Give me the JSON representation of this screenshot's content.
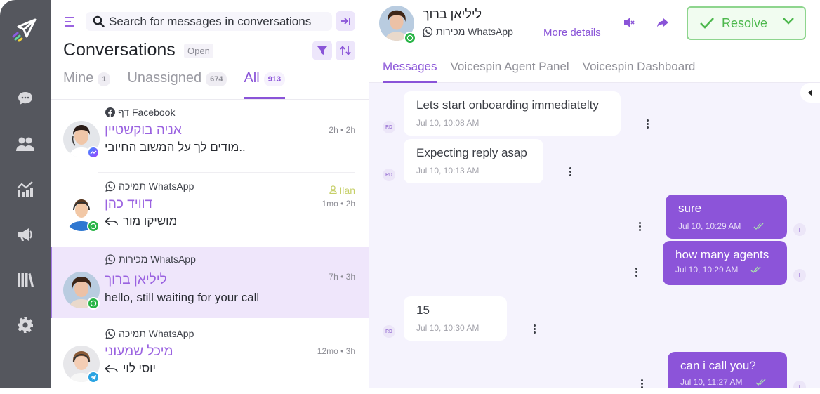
{
  "rail": {
    "logo": "paper-plane-logo",
    "items": [
      {
        "icon": "chat-bubble-icon",
        "label": "Conversations"
      },
      {
        "icon": "users-icon",
        "label": "Contacts"
      },
      {
        "icon": "chart-icon",
        "label": "Reports"
      },
      {
        "icon": "megaphone-icon",
        "label": "Campaigns"
      },
      {
        "icon": "library-icon",
        "label": "Library"
      },
      {
        "icon": "gear-icon",
        "label": "Settings"
      }
    ]
  },
  "list": {
    "search_placeholder": "Search for messages in conversations",
    "title": "Conversations",
    "status_badge": "Open",
    "tabs": [
      {
        "label": "Mine",
        "count": "1",
        "active": false
      },
      {
        "label": "Unassigned",
        "count": "674",
        "active": false
      },
      {
        "label": "All",
        "count": "913",
        "active": true
      }
    ],
    "conversations": [
      {
        "channel": "דף Facebook",
        "channel_icon": "facebook-icon",
        "name": "אניה בוקשטיין",
        "time": "2h • 2h",
        "preview": "מודים לך על המשוב החיובי..",
        "badge": "messenger-icon",
        "assignee": "",
        "reply": false,
        "selected": false
      },
      {
        "channel": "תמיכה WhatsApp",
        "channel_icon": "whatsapp-icon",
        "name": "דוויד כהן",
        "time": "1mo • 2h",
        "preview": "מושיקו מור",
        "badge": "whatsapp-icon",
        "assignee": "Ilan",
        "reply": true,
        "selected": false
      },
      {
        "channel": "מכירות WhatsApp",
        "channel_icon": "whatsapp-icon",
        "name": "ליליאן ברוך",
        "time": "7h • 3h",
        "preview": "hello, still waiting for your call",
        "badge": "whatsapp-icon",
        "assignee": "",
        "reply": false,
        "selected": true
      },
      {
        "channel": "תמיכה WhatsApp",
        "channel_icon": "whatsapp-icon",
        "name": "מיכל שמעוני",
        "time": "12mo • 3h",
        "preview": "יוסי לוי",
        "badge": "telegram-icon",
        "assignee": "",
        "reply": true,
        "selected": false
      }
    ]
  },
  "header": {
    "contact_name": "ליליאן ברוך",
    "channel": "מכירות WhatsApp",
    "more_details": "More details",
    "resolve_label": "Resolve",
    "tabs": [
      {
        "label": "Messages",
        "active": true
      },
      {
        "label": "Voicespin Agent Panel",
        "active": false
      },
      {
        "label": "Voicespin Dashboard",
        "active": false
      }
    ]
  },
  "messages": [
    {
      "direction": "in",
      "text": "Lets start onboarding immediatelty",
      "time": "Jul 10, 10:08 AM",
      "initials": "RD"
    },
    {
      "direction": "in",
      "text": "Expecting reply asap",
      "time": "Jul 10, 10:13 AM",
      "initials": "RD"
    },
    {
      "direction": "out",
      "text": "sure",
      "time": "Jul 10, 10:29 AM",
      "status": "read"
    },
    {
      "direction": "out",
      "text": "how many agents",
      "time": "Jul 10, 10:29 AM",
      "status": "read"
    },
    {
      "direction": "in",
      "text": "15",
      "time": "Jul 10, 10:30 AM",
      "initials": "RD"
    },
    {
      "direction": "out",
      "text": "can i call you?",
      "time": "Jul 10, 11:27 AM",
      "status": "read"
    }
  ],
  "colors": {
    "accent": "#8a54d8",
    "resolve": "#4db84d",
    "whatsapp": "#28b446",
    "selected_bg": "#efe6fb"
  }
}
